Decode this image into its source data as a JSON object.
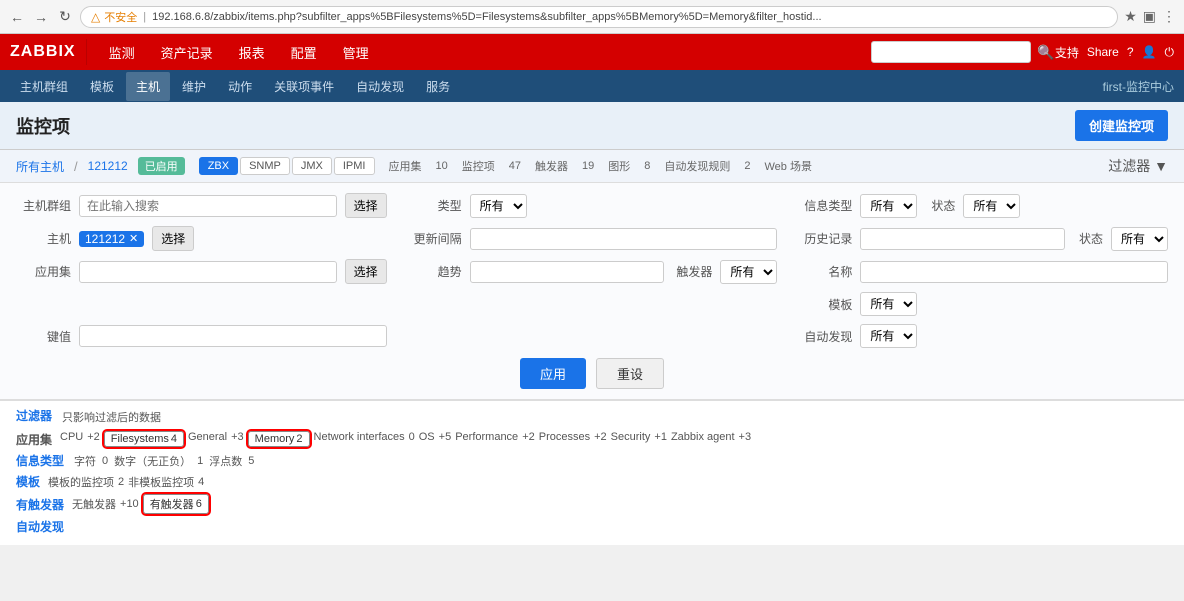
{
  "browser": {
    "address": "192.168.6.8/zabbix/items.php?subfilter_apps%5BFilesystems%5D=Filesystems&subfilter_apps%5BMemory%5D=Memory&filter_hostid...",
    "warning": "不安全",
    "actions": [
      "⟵",
      "⟶",
      "↻",
      "🏠",
      "⭐",
      "🔒",
      "⚙",
      "👤",
      "⋯"
    ]
  },
  "topnav": {
    "logo": "ZABBIX",
    "menu": [
      "监测",
      "资产记录",
      "报表",
      "配置",
      "管理"
    ],
    "search_placeholder": "",
    "support": "支持",
    "share": "Share",
    "help": "?",
    "user": "👤",
    "logout": "⏻",
    "right_label": "first-监控中心"
  },
  "secondarynav": {
    "items": [
      "主机群组",
      "模板",
      "主机",
      "维护",
      "动作",
      "关联项事件",
      "自动发现",
      "服务"
    ],
    "active": "主机",
    "right": "first-监控中心"
  },
  "page": {
    "title": "监控项",
    "create_btn": "创建监控项",
    "filter_btn": "过滤器"
  },
  "breadcrumbs": {
    "all": "所有主机",
    "host": "121212",
    "tabs": [
      {
        "label": "已启用",
        "type": "status"
      },
      {
        "label": "ZBX",
        "active": true
      },
      {
        "label": "SNMP"
      },
      {
        "label": "JMX"
      },
      {
        "label": "IPMI"
      },
      {
        "label": "应用集",
        "count": "10"
      },
      {
        "label": "监控项",
        "count": "47"
      },
      {
        "label": "触发器",
        "count": "19"
      },
      {
        "label": "图形",
        "count": "8"
      },
      {
        "label": "自动发现规则",
        "count": "2"
      },
      {
        "label": "Web 场景"
      }
    ]
  },
  "filter_form": {
    "host_group_label": "主机群组",
    "host_group_placeholder": "在此输入搜索",
    "host_group_btn": "选择",
    "type_label": "类型",
    "type_value": "所有",
    "type_options": [
      "所有"
    ],
    "info_type_label": "信息类型",
    "info_type_value": "所有",
    "info_type_options": [
      "所有"
    ],
    "status_label": "状态",
    "status_value": "所有",
    "status_options": [
      "所有"
    ],
    "host_label": "主机",
    "host_value": "121212",
    "host_btn": "选择",
    "update_interval_label": "更新间隔",
    "update_interval_value": "",
    "history_label": "历史记录",
    "history_value": "",
    "status2_label": "状态",
    "status2_value": "所有",
    "status2_options": [
      "所有"
    ],
    "app_label": "应用集",
    "app_placeholder": "",
    "app_btn": "选择",
    "trends_label": "趋势",
    "trends_value": "",
    "trigger_label": "触发器",
    "trigger_value": "所有",
    "trigger_options": [
      "所有"
    ],
    "name_label": "名称",
    "name_value": "",
    "template_label": "模板",
    "template_value": "所有",
    "template_options": [
      "所有"
    ],
    "key_label": "键值",
    "key_value": "",
    "auto_discover_label": "自动发现",
    "auto_discover_value": "所有",
    "auto_discover_options": [
      "所有"
    ],
    "apply_btn": "应用",
    "reset_btn": "重设"
  },
  "filter_result": {
    "title": "过滤器",
    "only_affected": "只影响过滤后的数据",
    "app_section_label": "应用集",
    "cpu_label": "CPU",
    "cpu_count": "+2",
    "filesystems_tag": "Filesystems",
    "filesystems_count": "4",
    "general_tag": "General",
    "general_count": "+3",
    "memory_tag": "Memory",
    "memory_count": "2",
    "network_tag": "Network interfaces",
    "network_count": "0",
    "os_tag": "OS",
    "os_count": "+5",
    "performance_tag": "Performance",
    "performance_count": "+2",
    "processes_tag": "Processes",
    "processes_count": "+2",
    "security_tag": "Security",
    "security_count": "+1",
    "zabbix_agent_tag": "Zabbix agent",
    "zabbix_agent_count": "+3",
    "info_type_section_label": "信息类型",
    "char_label": "字符",
    "char_count": "0",
    "num_label": "数字（无正负）",
    "num_count": "1",
    "float_label": "浮点数",
    "float_count": "5",
    "template_section_label": "模板",
    "template_monitored": "模板的监控项",
    "template_monitored_count": "2",
    "template_non": "非模板监控项",
    "template_non_count": "4",
    "trigger_section_label": "有触发器",
    "no_trigger_label": "无触发器",
    "no_trigger_count": "+10",
    "has_trigger_label": "有触发器",
    "has_trigger_count": "6",
    "auto_section_label": "自动发现"
  }
}
